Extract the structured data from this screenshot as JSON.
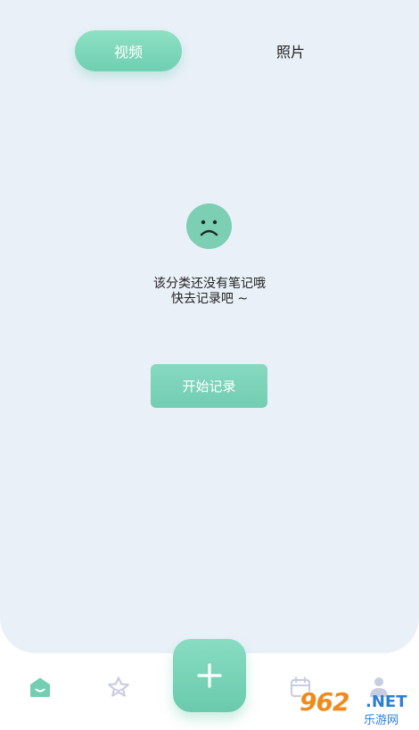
{
  "tabs": [
    {
      "label": "视频",
      "active": true
    },
    {
      "label": "照片",
      "active": false
    }
  ],
  "empty_state": {
    "icon": "sad-face-icon",
    "line1": "该分类还没有笔记哦",
    "line2": "快去记录吧 ~",
    "button_label": "开始记录"
  },
  "bottom_nav": {
    "items": [
      {
        "icon": "home-icon"
      },
      {
        "icon": "star-icon"
      },
      {
        "icon": "plus-icon"
      },
      {
        "icon": "calendar-icon"
      },
      {
        "icon": "profile-icon"
      }
    ]
  },
  "watermark": {
    "logo": "962",
    "net": ".NET",
    "sub": "乐游网"
  },
  "colors": {
    "accent": "#72cdb1",
    "panel_bg": "#eaf0f8",
    "nav_icon_inactive": "#c9cde0"
  }
}
